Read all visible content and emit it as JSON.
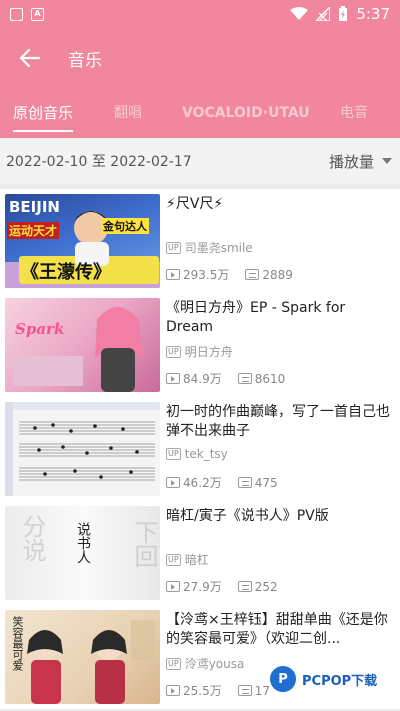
{
  "status_bar": {
    "time": "5:37"
  },
  "app_bar": {
    "title": "音乐"
  },
  "tabs": [
    {
      "label": "原创音乐",
      "active": true
    },
    {
      "label": "翻唱",
      "active": false
    },
    {
      "label": "VOCALOID·UTAU",
      "active": false
    },
    {
      "label": "电音",
      "active": false
    }
  ],
  "filter": {
    "date_start": "2022-02-10",
    "date_separator": "至",
    "date_end": "2022-02-17",
    "sort_label": "播放量"
  },
  "videos": [
    {
      "title": "⚡尺V尺⚡",
      "uploader": "司墨尧smile",
      "views": "293.5万",
      "danmaku": "2889",
      "thumb_text": [
        "BEIJIN",
        "运动天才",
        "金句达人",
        "《王濛传》"
      ]
    },
    {
      "title": "《明日方舟》EP - Spark for Dream",
      "uploader": "明日方舟",
      "views": "84.9万",
      "danmaku": "8610",
      "thumb_text": [
        "Spark"
      ]
    },
    {
      "title": "初一时的作曲巅峰，写了一首自己也弹不出来曲子",
      "uploader": "tek_tsy",
      "views": "46.2万",
      "danmaku": "475",
      "thumb_text": []
    },
    {
      "title": "暗杠/寅子《说书人》PV版",
      "uploader": "暗杠",
      "views": "27.9万",
      "danmaku": "252",
      "thumb_text": [
        "说书人",
        "分说",
        "下回"
      ]
    },
    {
      "title": "【泠鸢×王梓钰】甜甜单曲《还是你的笑容最可爱》（欢迎二创...",
      "uploader": "泠鸢yousa",
      "views": "25.5万",
      "danmaku": "17",
      "thumb_text": [
        "笑容最可爱"
      ]
    }
  ],
  "up_badge": "UP",
  "watermark": {
    "logo": "P",
    "text": "PCPOP下载"
  }
}
